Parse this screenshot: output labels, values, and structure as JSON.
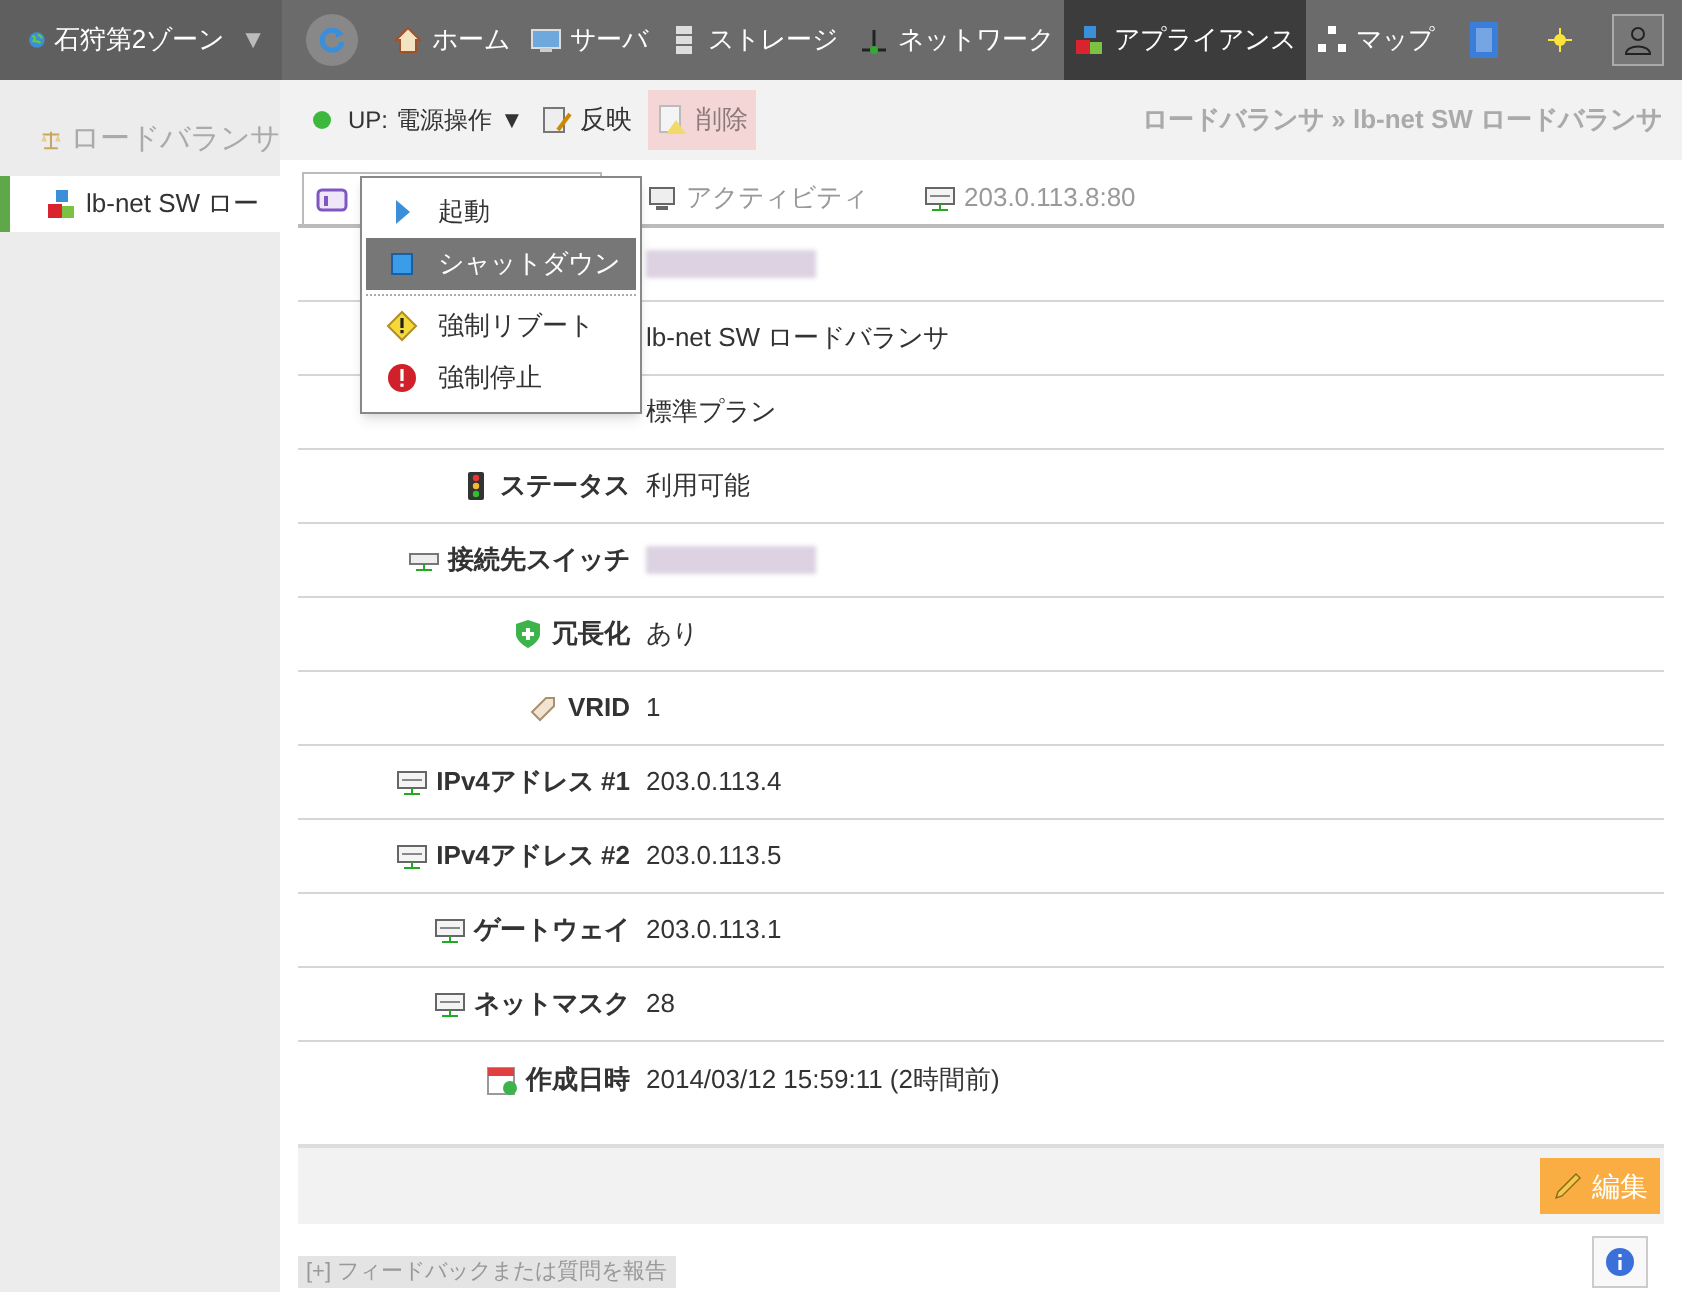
{
  "zone": {
    "label": "石狩第2ゾーン",
    "caret": "▼"
  },
  "nav": [
    {
      "label": "ホーム",
      "selected": false
    },
    {
      "label": "サーバ",
      "selected": false
    },
    {
      "label": "ストレージ",
      "selected": false
    },
    {
      "label": "ネットワーク",
      "selected": false
    },
    {
      "label": "アプライアンス",
      "selected": true
    },
    {
      "label": "マップ",
      "selected": false
    }
  ],
  "sidebar": {
    "heading": "ロードバランサ",
    "items": [
      {
        "label": "lb-net SW ロー",
        "selected": true
      }
    ]
  },
  "toolbar": {
    "status": "UP:",
    "power": "電源操作",
    "caret": "▼",
    "reflect": "反映",
    "delete": {
      "label": "削除",
      "disabled": true
    }
  },
  "breadcrumb": "ロードバランサ » lb-net SW ロードバランサ",
  "tabs": [
    {
      "selected": true
    },
    {
      "label": "アクティビティ",
      "selected": false
    },
    {
      "label": "203.0.113.8:80",
      "selected": false
    }
  ],
  "power_menu": [
    {
      "label": "起動",
      "selected": false
    },
    {
      "label": "シャットダウン",
      "selected": true
    },
    {
      "label": "強制リブート",
      "selected": false
    },
    {
      "label": "強制停止",
      "selected": false
    }
  ],
  "details": [
    {
      "kind": "redacted"
    },
    {
      "kind": "text",
      "value": "lb-net SW ロードバランサ"
    },
    {
      "kind": "text",
      "value": "標準プラン"
    },
    {
      "kind": "text",
      "label": "ステータス",
      "value": "利用可能"
    },
    {
      "kind": "redacted",
      "label": "接続先スイッチ"
    },
    {
      "kind": "text",
      "label": "冗長化",
      "value": "あり"
    },
    {
      "kind": "text",
      "label": "VRID",
      "value": "1"
    },
    {
      "kind": "text",
      "label": "IPv4アドレス #1",
      "value": "203.0.113.4"
    },
    {
      "kind": "text",
      "label": "IPv4アドレス #2",
      "value": "203.0.113.5"
    },
    {
      "kind": "text",
      "label": "ゲートウェイ",
      "value": "203.0.113.1"
    },
    {
      "kind": "text",
      "label": "ネットマスク",
      "value": "28"
    },
    {
      "kind": "text",
      "label": "作成日時",
      "value": "2014/03/12 15:59:11 (2時間前)"
    }
  ],
  "edit_button": "編集",
  "feedback": "[+] フィードバックまたは質問を報告"
}
